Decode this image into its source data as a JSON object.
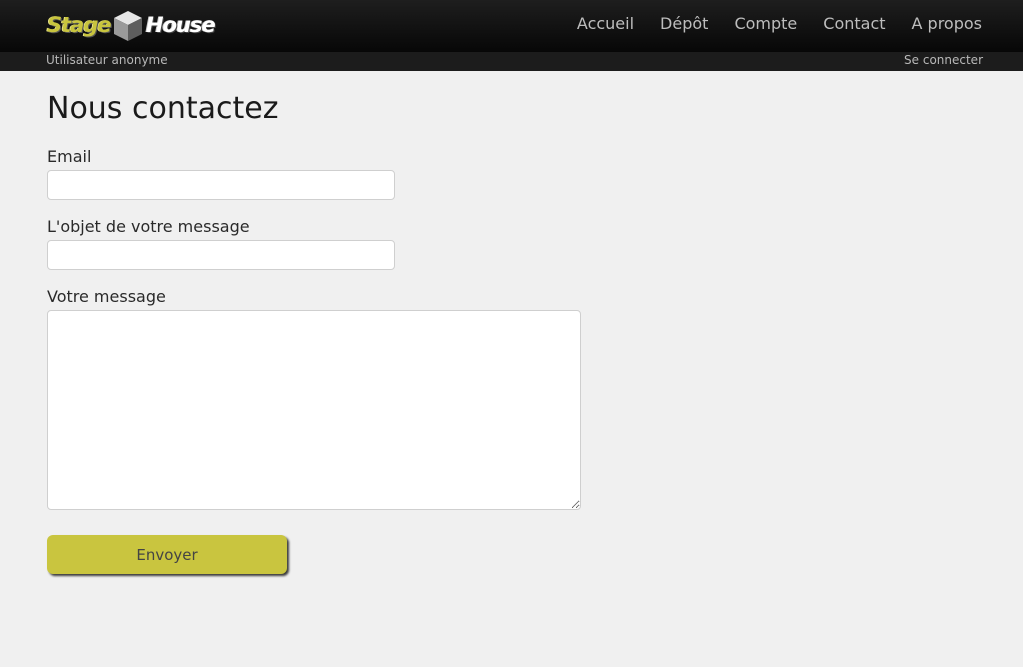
{
  "header": {
    "logo": {
      "word1": "Stage",
      "word2": "House",
      "icon": "cube-icon"
    },
    "nav": [
      "Accueil",
      "Dépôt",
      "Compte",
      "Contact",
      "A propos"
    ]
  },
  "subbar": {
    "user": "Utilisateur anonyme",
    "login": "Se connecter"
  },
  "form": {
    "title": "Nous contactez",
    "email_label": "Email",
    "email_value": "",
    "subject_label": "L'objet de votre message",
    "subject_value": "",
    "message_label": "Votre message",
    "message_value": "",
    "submit_label": "Envoyer"
  },
  "colors": {
    "accent": "#c9c53f",
    "header_bg": "#0e0e0e",
    "page_bg": "#f0f0f0"
  }
}
